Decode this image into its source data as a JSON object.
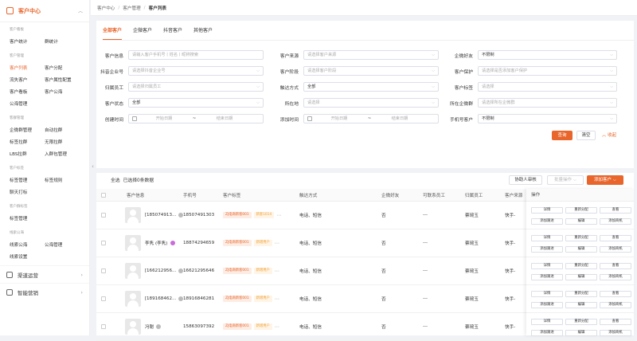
{
  "sidebar": {
    "header": "客户中心",
    "groups": [
      {
        "title": "客户看板",
        "rows": [
          [
            "客户统计",
            "群统计"
          ]
        ]
      },
      {
        "title": "客户管理",
        "rows": [
          [
            "客户列表",
            "客户分配"
          ],
          [
            "流失客户",
            "客户属性配置"
          ],
          [
            "客户看板",
            "客户公海"
          ],
          [
            "公海管理",
            ""
          ]
        ]
      },
      {
        "title": "客群管理",
        "rows": [
          [
            "企微群管理",
            "自动拉群"
          ],
          [
            "标签拉群",
            "无限拉群"
          ],
          [
            "LBS拉群",
            "入群包管理"
          ]
        ]
      },
      {
        "title": "客户标签",
        "rows": [
          [
            "标签管理",
            "标签规则"
          ],
          [
            "聊天打标",
            ""
          ]
        ]
      },
      {
        "title": "客户群标签",
        "rows": [
          [
            "标签管理",
            ""
          ]
        ]
      },
      {
        "title": "线索公海",
        "rows": [
          [
            "线索公海",
            "公海管理"
          ],
          [
            "线索设置",
            ""
          ]
        ]
      }
    ],
    "main_items": [
      "渠道运营",
      "智能营销"
    ]
  },
  "breadcrumb": {
    "a": "客户中心",
    "b": "客户管理",
    "c": "客户列表"
  },
  "tabs": [
    "全部客户",
    "企微客户",
    "抖音客户",
    "其他客户"
  ],
  "filters": {
    "r1": {
      "l1": "客户信息",
      "p1": "请输入客户手机号丨姓名丨昵称搜索",
      "l2": "客户来源",
      "p2": "请选择客户来源",
      "l3": "企微好友",
      "v3": "不限制"
    },
    "r2": {
      "l1": "抖音企业号",
      "p1": "请选择抖音企业号",
      "l2": "客户阶段",
      "p2": "请选择客户阶段",
      "l3": "客户保护",
      "p3": "请选择是否添加客户保护"
    },
    "r3": {
      "l1": "归属员工",
      "p1": "请选择归属员工",
      "l2": "触达方式",
      "v2": "全部",
      "l3": "客户标签",
      "p3": "请选择"
    },
    "r4": {
      "l1": "客户状态",
      "v1": "全部",
      "l2": "所在地",
      "p2": "请选择",
      "l3": "所在企微群",
      "p3": "请选择所在企微群"
    },
    "r5": {
      "l1": "创建时间",
      "s1": "开始日期",
      "e1": "结束日期",
      "l2": "添加时间",
      "s2": "开始日期",
      "e2": "结束日期",
      "l3": "手机号客户",
      "v3": "不限制"
    },
    "tilde": "~"
  },
  "actions": {
    "query": "查询",
    "clear": "清空",
    "collapse": "收起"
  },
  "toolbar": {
    "select_all": "全选",
    "selected": "已选择0条数据",
    "assist": "协助人审核",
    "batch": "批量操作",
    "add": "添加客户"
  },
  "table": {
    "headers": [
      "客户信息",
      "手机号",
      "客户标签",
      "触达方式",
      "企微好友",
      "可联系员工",
      "归属员工",
      "客户来源",
      "操作"
    ],
    "rows": [
      {
        "name": "[185074913...",
        "phone": "18507491303",
        "tag1": "ZJ电商新客001",
        "tag2": "新客1014",
        "way": "电话、短信",
        "friend": "否",
        "staff": "---",
        "owner": "蔡琬玉",
        "src": "快手-"
      },
      {
        "name": "李隽 (李隽)",
        "phone": "18874294659",
        "tag1": "ZJ电商新客001",
        "tag2": "新增用户",
        "way": "电话、短信",
        "friend": "否",
        "staff": "---",
        "owner": "蔡琬玉",
        "src": "快手-"
      },
      {
        "name": "[166212956...",
        "phone": "16621295646",
        "tag1": "ZJ电商新客001",
        "tag2": "新增用户",
        "way": "电话、短信",
        "friend": "否",
        "staff": "---",
        "owner": "蔡琬玉",
        "src": "快手-"
      },
      {
        "name": "[189168462...",
        "phone": "18916846281",
        "tag1": "ZJ电商新客001",
        "tag2": "新增用户",
        "way": "电话、短信",
        "friend": "否",
        "staff": "---",
        "owner": "蔡琬玉",
        "src": "快手-"
      },
      {
        "name": "冯聪",
        "phone": "15863097392",
        "tag1": "ZJ电商新客001",
        "tag2": "新增用户",
        "way": "电话、短信",
        "friend": "否",
        "staff": "---",
        "owner": "蔡琬玉",
        "src": "快手-"
      }
    ],
    "ops": [
      "详情",
      "重新分配",
      "查看",
      "添加跟进",
      "编辑",
      "添加商机"
    ]
  }
}
